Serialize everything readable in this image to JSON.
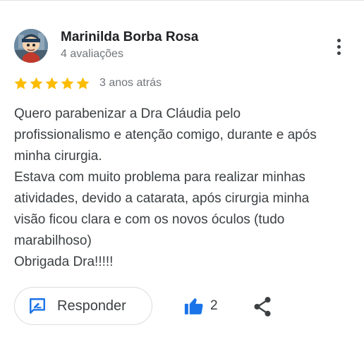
{
  "author": {
    "name": "Marinilda Borba Rosa",
    "review_count": "4 avaliações",
    "avatar_icon": "cartoon-character-avatar"
  },
  "rating": {
    "stars": 5,
    "max_stars": 5,
    "star_color": "#fbbc04",
    "date": "3 anos atrás"
  },
  "review": {
    "lines": [
      "Quero parabenizar a Dra Cláudia pelo",
      "profissionalismo e atenção comigo, durante e após",
      "minha cirurgia.",
      "Estava com muito problema para realizar minhas",
      "atividades, devido a catarata, após cirurgia minha",
      "visão ficou clara e com os novos óculos (tudo",
      "marabilhoso)",
      "Obrigada Dra!!!!!"
    ]
  },
  "actions": {
    "reply_label": "Responder",
    "reply_icon": "reply-comment-icon",
    "like_count": "2",
    "like_icon": "thumbs-up-icon",
    "share_icon": "share-icon",
    "more_icon": "more-vertical-icon",
    "accent_color": "#1a73e8"
  }
}
